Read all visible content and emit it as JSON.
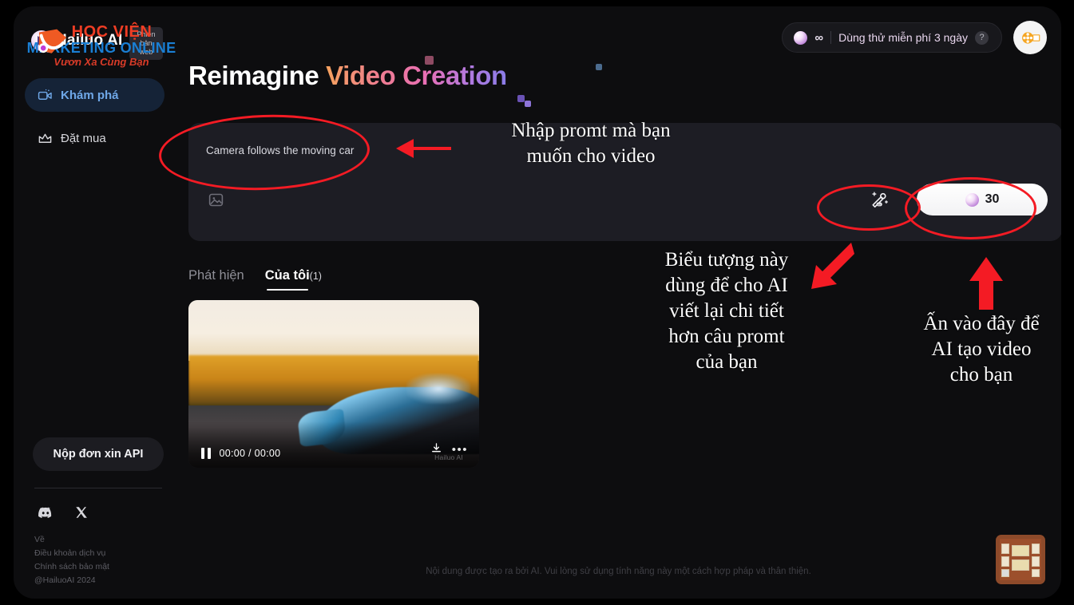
{
  "watermark": {
    "line1": "HỌC VIỆN",
    "line2": "MARKETING ONLINE",
    "line3": "Vươn Xa Cùng Bạn"
  },
  "sidebar": {
    "logo_text": "Hailuo AI",
    "logo_badge": "Phiên bản web",
    "items": [
      {
        "label": "Khám phá",
        "icon": "video-camera-icon",
        "active": true
      },
      {
        "label": "Đặt mua",
        "icon": "crown-icon",
        "active": false
      }
    ],
    "api_button": "Nộp đơn xin API",
    "socials": [
      {
        "name": "discord-icon"
      },
      {
        "name": "x-twitter-icon"
      }
    ],
    "footer_links": [
      "Về",
      "Điều khoản dịch vụ",
      "Chính sách bảo mật",
      "@HailuoAI 2024"
    ]
  },
  "topbar": {
    "credits": "∞",
    "trial_text": "Dùng thử miễn phí 3 ngày",
    "help": "?",
    "avatar_icon": "film-reel-icon"
  },
  "hero": {
    "part_white": "Reimagine ",
    "part_gradient": "Video Creation"
  },
  "prompt": {
    "value": "Camera follows the moving car",
    "placeholder": "Camera follows the moving car",
    "upload_icon": "image-upload-icon",
    "enhance_icon": "ai-rewrite-wand-icon",
    "generate_cost": "30"
  },
  "tabs": [
    {
      "label": "Phát hiện",
      "count": "",
      "active": false
    },
    {
      "label": "Của tôi",
      "count": "(1)",
      "active": true
    }
  ],
  "video": {
    "pause_icon": "pause-icon",
    "time": "00:00 / 00:00",
    "download_icon": "download-icon",
    "more_icon": "more-options-icon",
    "watermark": "Hailuo AI"
  },
  "notice": "Nội dung được tạo ra bởi AI. Vui lòng sử dụng tính năng này một cách hợp pháp và thân thiện.",
  "annotations": [
    {
      "id": "a1",
      "text": "Nhập promt mà bạn\nmuốn cho video"
    },
    {
      "id": "a2",
      "text": "Biểu tượng này\ndùng để cho AI\nviết lại chi tiết\nhơn câu promt\ncủa bạn"
    },
    {
      "id": "a3",
      "text": "Ấn vào đây để\nAI tạo video\ncho bạn"
    }
  ],
  "colors": {
    "annotation_red": "#f41b24",
    "accent_blue": "#6fa8e8",
    "app_bg": "#0d0d0f",
    "card_bg": "#1d1d24"
  }
}
